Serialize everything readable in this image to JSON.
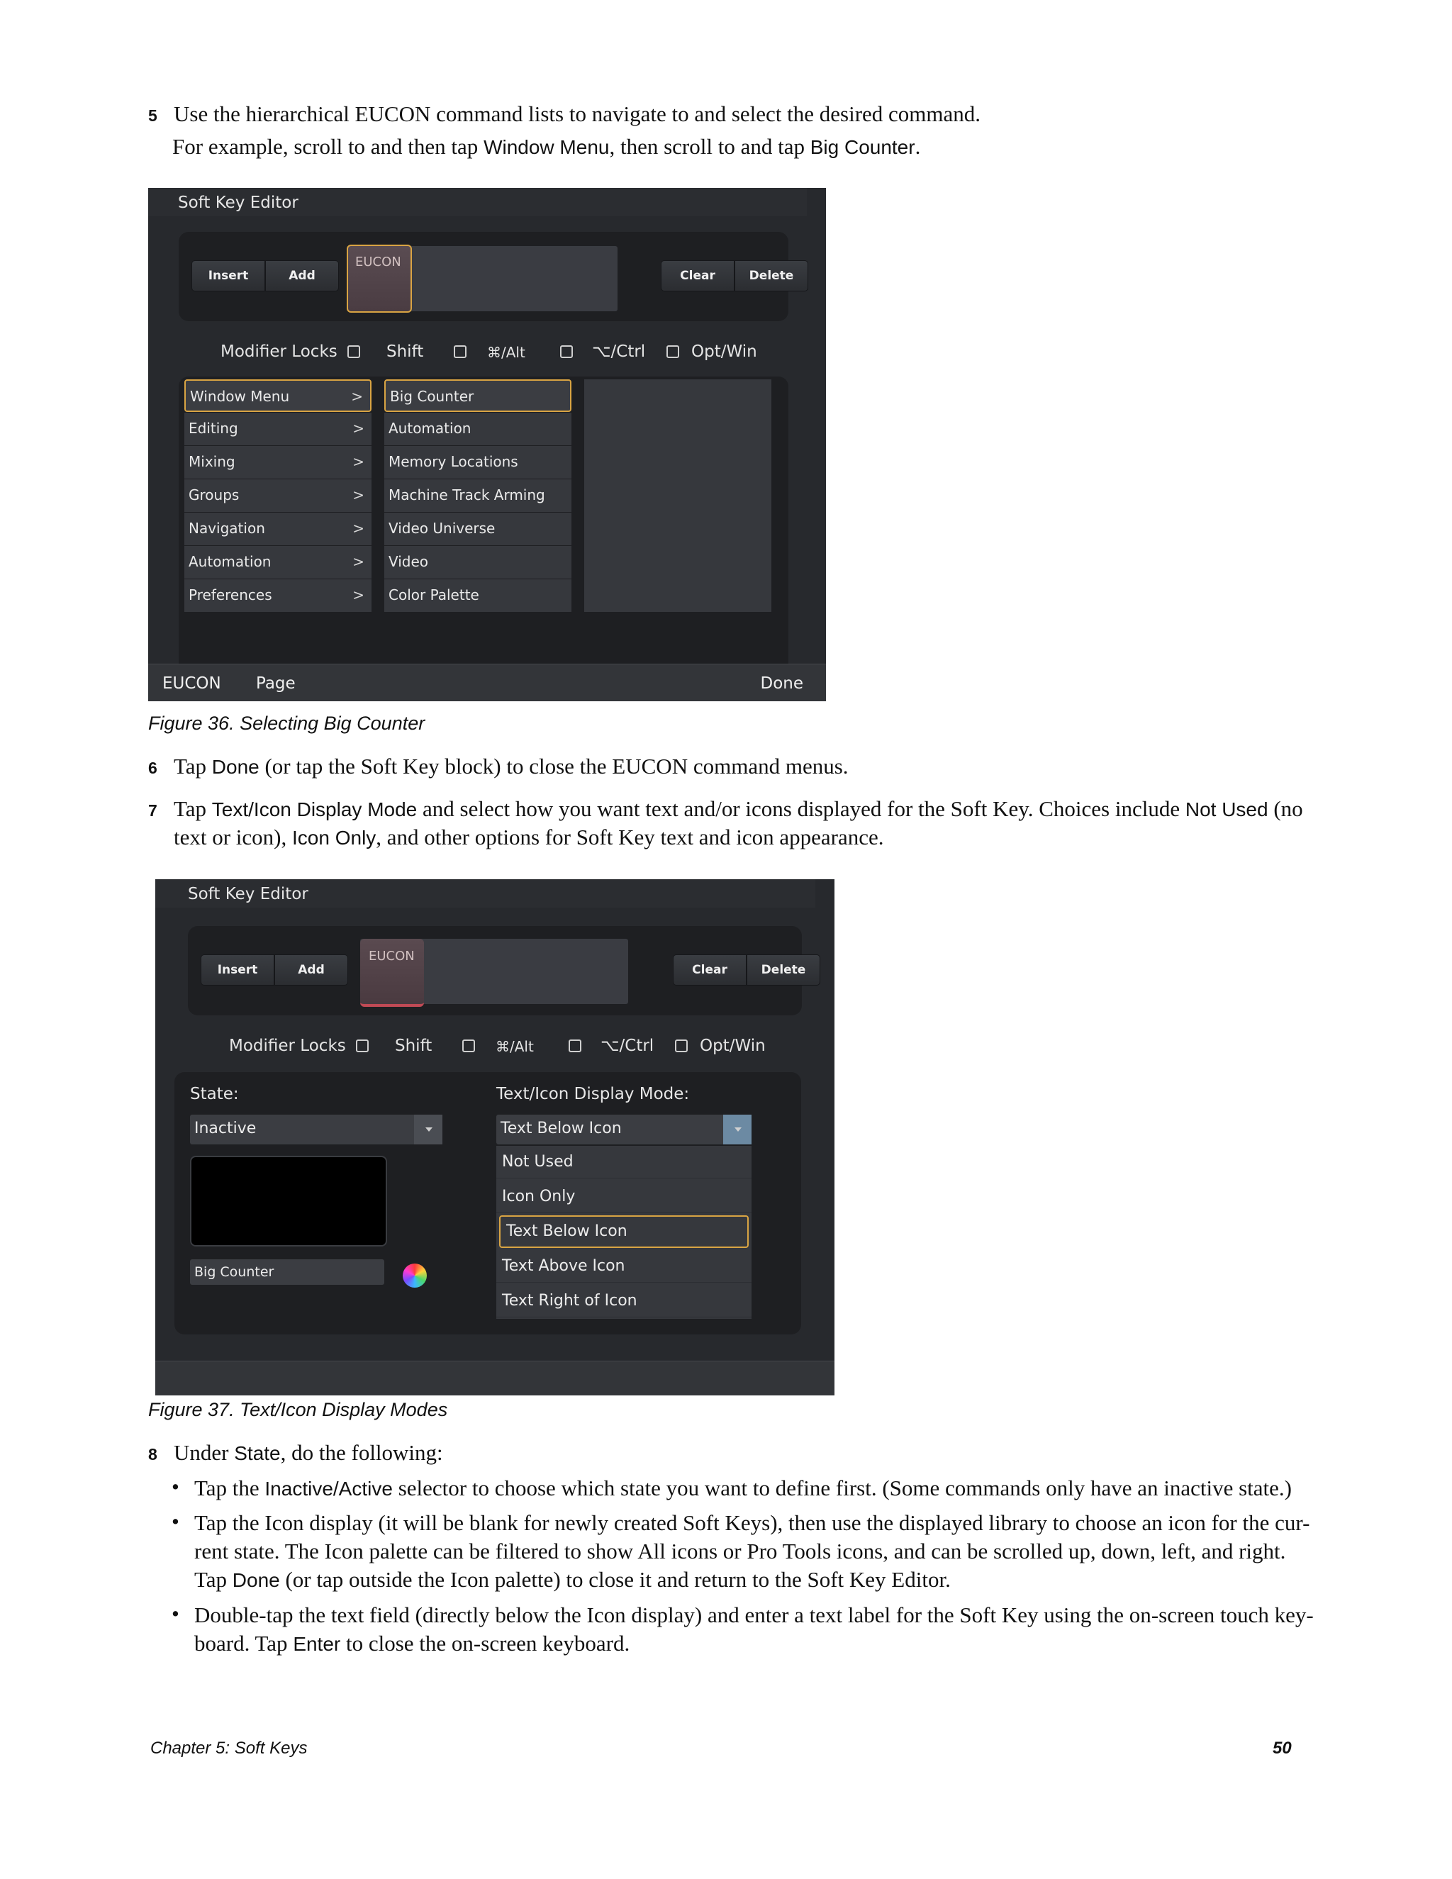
{
  "step5": {
    "num": "5",
    "text": "Use the hierarchical EUCON command lists to navigate to and select the desired command.",
    "line2_a": "For example, scroll to and then tap ",
    "line2_b": "Window Menu",
    "line2_c": ", then scroll to and tap ",
    "line2_d": "Big Counter",
    "line2_e": "."
  },
  "fig36": {
    "title": "Soft Key Editor",
    "insert": "Insert",
    "add": "Add",
    "eucon_key": "EUCON",
    "clear": "Clear",
    "delete": "Delete",
    "modifier_locks": "Modifier Locks",
    "mod_shift": "Shift",
    "mod_alt": "⌘/Alt",
    "mod_ctrl": "⌥/Ctrl",
    "mod_optwin": "Opt/Win",
    "col1": [
      "Window Menu",
      "Editing",
      "Mixing",
      "Groups",
      "Navigation",
      "Automation",
      "Preferences"
    ],
    "col2": [
      "Big Counter",
      "Automation",
      "Memory Locations",
      "Machine Track Arming",
      "Video Universe",
      "Video",
      "Color Palette"
    ],
    "bottom_eucon": "EUCON",
    "bottom_page": "Page",
    "bottom_done": "Done",
    "caption": "Figure 36. Selecting Big Counter"
  },
  "step6": {
    "num": "6",
    "a": "Tap ",
    "b": "Done",
    "c": " (or tap the Soft Key block) to close the EUCON command menus."
  },
  "step7": {
    "num": "7",
    "a": "Tap ",
    "b": "Text/Icon Display Mode",
    "c": " and select how you want text and/or icons displayed for the Soft Key. Choices include ",
    "d": "Not Used",
    "e": " (no",
    "line2_a": "text or icon), ",
    "line2_b": "Icon Only",
    "line2_c": ", and other options for Soft Key text and icon appearance."
  },
  "fig37": {
    "title": "Soft Key Editor",
    "insert": "Insert",
    "add": "Add",
    "eucon_key": "EUCON",
    "clear": "Clear",
    "delete": "Delete",
    "modifier_locks": "Modifier Locks",
    "mod_shift": "Shift",
    "mod_alt": "⌘/Alt",
    "mod_ctrl": "⌥/Ctrl",
    "mod_optwin": "Opt/Win",
    "state_label": "State:",
    "state_value": "Inactive",
    "mode_label": "Text/Icon Display Mode:",
    "mode_value": "Text Below Icon",
    "mode_options": [
      "Not Used",
      "Icon Only",
      "Text Below Icon",
      "Text Above Icon",
      "Text Right of Icon"
    ],
    "text_field_value": "Big Counter",
    "caption": "Figure 37. Text/Icon Display Modes"
  },
  "step8": {
    "num": "8",
    "a": "Under ",
    "b": "State",
    "c": ", do the following:",
    "bullet1_a": "Tap the ",
    "bullet1_b": "Inactive/Active",
    "bullet1_c": " selector to choose which state you want to define first. (Some commands only have an inactive state.)",
    "bullet2_l1": "Tap the Icon display (it will be blank for newly created Soft Keys), then use the displayed library to choose an icon for the cur-",
    "bullet2_l2": "rent state. The Icon palette can be filtered to show All icons or Pro Tools icons, and can be scrolled up, down, left, and right.",
    "bullet2_l3a": "Tap ",
    "bullet2_l3b": "Done",
    "bullet2_l3c": " (or tap outside the Icon palette) to close it and return to the Soft Key Editor.",
    "bullet3_l1": "Double-tap the text field (directly below the Icon display) and enter a text label for the Soft Key using the on-screen touch key-",
    "bullet3_l2a": "board. Tap ",
    "bullet3_l2b": "Enter",
    "bullet3_l2c": " to close the on-screen keyboard."
  },
  "footer": {
    "chapter": "Chapter 5: Soft Keys",
    "page": "50"
  },
  "colors": {
    "selection_outline": "#d9a443",
    "editor_background": "#27292d",
    "dropdown_arrow_active": "#6c8aa3"
  }
}
